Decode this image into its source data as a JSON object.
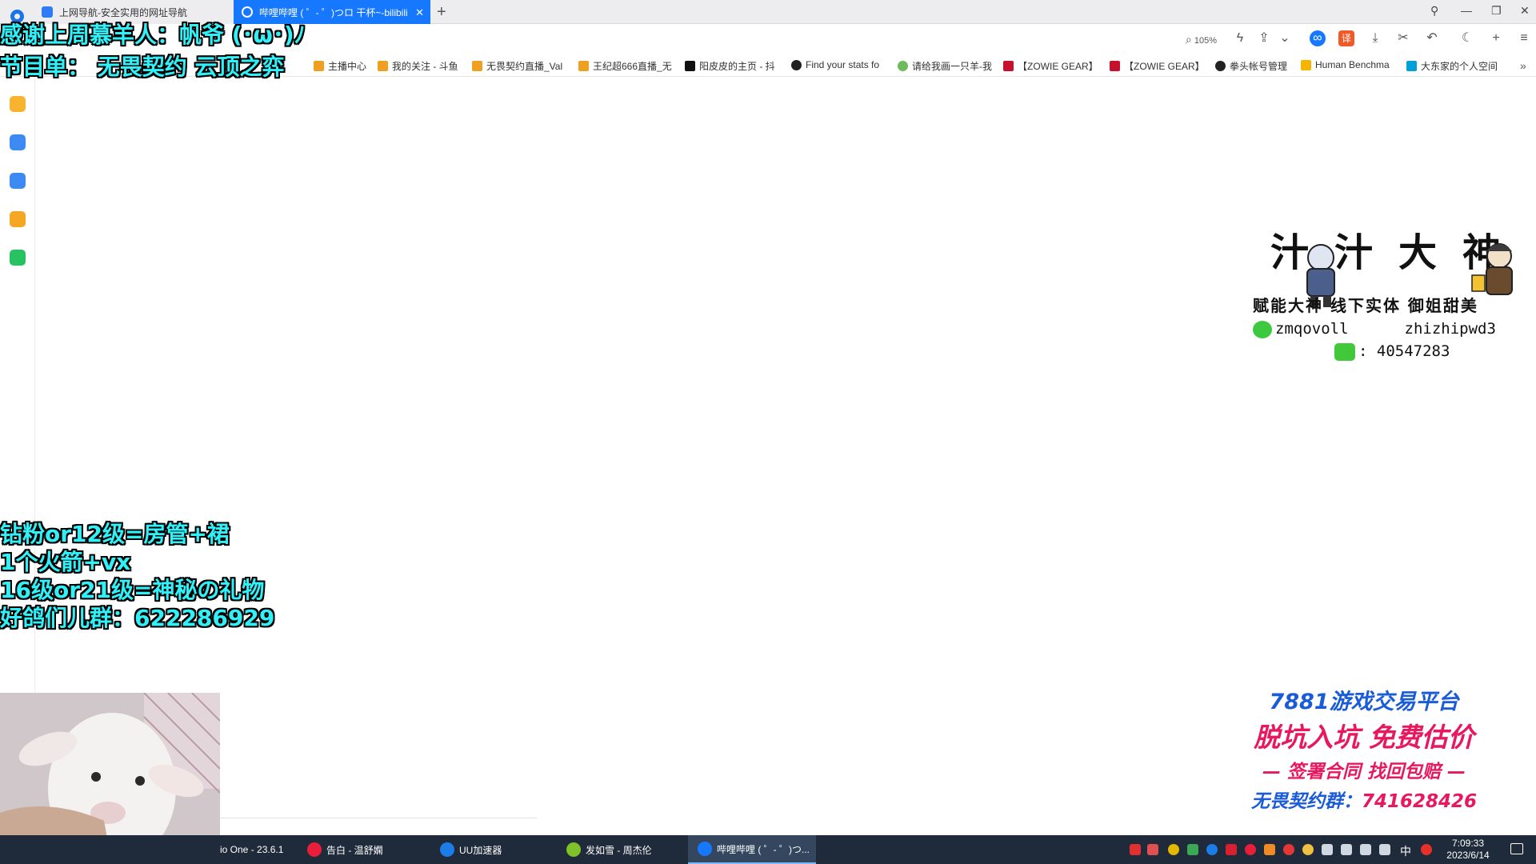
{
  "tabs": [
    {
      "label": "上网导航-安全实用的网址导航"
    },
    {
      "label": "哔哩哔哩 ( ゜- ゜)つロ 干杯~-bilibili"
    }
  ],
  "toolbar": {
    "zoom": "105%"
  },
  "bookmarks": [
    {
      "label": "主播中心",
      "color": "#f0a020"
    },
    {
      "label": "我的关注 - 斗鱼",
      "color": "#f0a020"
    },
    {
      "label": "无畏契约直播_Val",
      "color": "#f0a020"
    },
    {
      "label": "王纪超666直播_无",
      "color": "#f0a020"
    },
    {
      "label": "阳皮皮的主页 - 抖",
      "color": "#111111"
    },
    {
      "label": "Find your stats fo",
      "color": "#222222"
    },
    {
      "label": "请给我画一只羊-我",
      "color": "#6dbb5a"
    },
    {
      "label": "【ZOWIE GEAR】",
      "color": "#c8102e"
    },
    {
      "label": "【ZOWIE GEAR】",
      "color": "#c8102e"
    },
    {
      "label": "拳头帐号管理",
      "color": "#222222"
    },
    {
      "label": "Human Benchma",
      "color": "#f5b400"
    },
    {
      "label": "大东家的个人空间",
      "color": "#00a1d6"
    }
  ],
  "overlay": {
    "thanks_line": "感谢上周慕羊人：帆爷 (･ω･)ﾉ",
    "program_line": "节目单：  无畏契约 云顶之弈",
    "perks": [
      "钻粉or12级=房管+裙",
      "1个火箭+vx",
      "16级or21级=神秘の礼物",
      "好鸽们儿群：622286929"
    ],
    "brand": {
      "title": "汁汁大神",
      "subtitle": "赋能大神 线下实体 御姐甜美",
      "wechat_1": "zmqovoll",
      "wechat_2": "zhizhipwd3",
      "qq": ": 40547283"
    },
    "promo": {
      "line1": "7881游戏交易平台",
      "line2": "脱坑入坑 免费估价",
      "line3": "— 签署合同 找回包赔 —",
      "line4_label": "无畏契约群：",
      "line4_number": "741628426"
    }
  },
  "taskbar": {
    "items": [
      {
        "label": "io One - 23.6.1",
        "color": "#888888"
      },
      {
        "label": "告白 - 温舒嫻",
        "color": "#e81e3a"
      },
      {
        "label": "UU加速器",
        "color": "#1c7de8"
      },
      {
        "label": "发如雪 - 周杰伦",
        "color": "#7ec12a"
      },
      {
        "label": "哔哩哔哩 ( ゜- ゜)つ...",
        "color": "#1677ff"
      }
    ],
    "ime": "中",
    "time": "7:09:33",
    "date": "2023/6/14"
  }
}
